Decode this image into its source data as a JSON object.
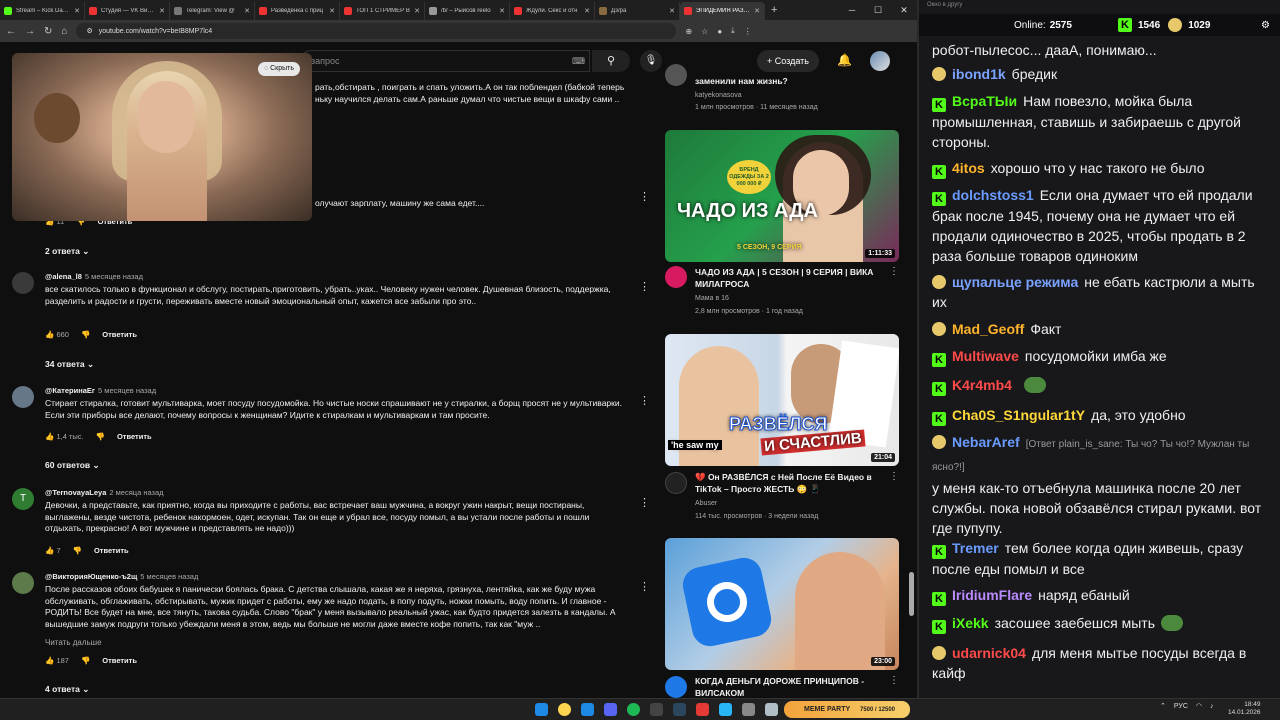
{
  "browser": {
    "tabs": [
      {
        "label": "Stream – Kick Dashboard"
      },
      {
        "label": "Студия — VK Видео"
      },
      {
        "label": "Telegram: View @"
      },
      {
        "label": "Разведёнка с приц"
      },
      {
        "label": "ТОП 1 СТРИМЕР В"
      },
      {
        "label": "/b/ – Рыисов reelо"
      },
      {
        "label": "Ждули. Секс и отн"
      },
      {
        "label": "Дз/ра"
      },
      {
        "label": "ЭПИДЕМИЯ РАЗВЕ"
      }
    ],
    "url": "youtube.com/watch?v=beIB8MP7lc4"
  },
  "youtube": {
    "search_placeholder": "запрос",
    "create_label": "Создать",
    "hide_label": "Скрыть",
    "reply_label": "Ответить",
    "read_more": "Читать дальше",
    "partial_comment": {
      "line1": "рать,обстирать , поиграть и спать уложить.А он так поблендел (бабкой теперь",
      "line2": "ньку научился делать сам.А раньше думал что чистые вещи в шкафу сами ..",
      "line3": "олучают зарплату, машину же сама едет....",
      "likes": "11",
      "replies": "2 ответа"
    },
    "comments": [
      {
        "author": "@alena_l8",
        "time": "5 месяцев назад",
        "text": "все скатилось только в функционал и обслугу, постирать,приготовить, убрать..уках.. Человеку нужен человек. Душевная близость, поддержка, разделить и радости и грусти, переживать вместе новый эмоциональный опыт, кажется все забыли про это..",
        "likes": "660",
        "replies": "34 ответа",
        "avatar": ""
      },
      {
        "author": "@КатеринаЕг",
        "time": "5 месяцев назад",
        "text": "Стирает стиралка, готовит мультиварка, моет посуду посудомойка. Но чистые носки спрашивают не у стиралки, а борщ просят не у мультиварки. Если эти приборы все делают, почему вопросы к женщинам? Идите к стиралкам и мультиваркам и там просите.",
        "likes": "1,4 тыс.",
        "replies": "60 ответов",
        "avatar": ""
      },
      {
        "author": "@TernovayaLeya",
        "time": "2 месяца назад",
        "text": "Девочки, а представьте, как приятно, когда вы приходите с работы, вас встречает ваш мужчина, а вокруг ужин накрыт, вещи постираны, выглажены, везде чистота, ребенок накормоен, одет, искупан. Так он еще и убрал все, посуду помыл, а вы устали после работы и пошли отдыхать, прекрасно! А вот мужчине и представлять не надо)))",
        "likes": "7",
        "replies": "",
        "avatar": "T"
      },
      {
        "author": "@ВикторияЮщенко-ъ2щ",
        "time": "5 месяцев назад",
        "text": "После рассказов обоих бабушек я панически боялась брака. С детства слышала, какая же я неряха, грязнуха, лентяйка, как же буду мужа обслуживать, обглаживать, обстирывать, мужик придет с работы, ему же надо подать, в попу подуть, ножки помыть, воду попить. И главное - РОДИТЬ! Все будет на мне, все тянуть, такова судьба. Слово \"брак\" у меня вызывало реальный ужас, как будто придется залезть в кандалы. А вышедшие замуж подруги только убеждали меня в этом, ведь мы больше не могли даже вместе кофе попить, так как \"муж ..",
        "likes": "187",
        "replies": "4 ответа",
        "avatar": ""
      }
    ],
    "related": [
      {
        "title": "заменили нам жизнь?",
        "channel": "katyekonasova",
        "meta": "1 млн просмотров · 11 месяцев назад",
        "duration": ""
      },
      {
        "title": "ЧАДО ИЗ АДА | 5 СЕЗОН | 9 СЕРИЯ | ВИКА МИЛАГРОСА",
        "channel": "Мама в 16",
        "meta": "2,8 млн просмотров · 1 год назад",
        "duration": "1:11:33",
        "thumb_text": "ЧАДО ИЗ АДА",
        "thumb_sub": "5 СЕЗОН, 9 СЕРИЯ",
        "thumb_badge": "БРЕНД ОДЕЖДЫ ЗА 2 000 000 ₽"
      },
      {
        "title": "💔 Он РАЗВЁЛСЯ с Ней После Её Видео в TikTok – Просто ЖЕСТЬ 😳 📱",
        "channel": "Abuser",
        "meta": "114 тыс. просмотров · 3 недели назад",
        "duration": "21:04",
        "thumb_text": "РАЗВЁЛСЯ",
        "thumb_sub": "И СЧАСТЛИВ",
        "thumb_caption": "'he saw my"
      },
      {
        "title": "КОГДА ДЕНЬГИ ДОРОЖЕ ПРИНЦИПОВ - ВИЛСАКОМ",
        "channel": "",
        "meta": "",
        "duration": "23:00"
      }
    ]
  },
  "chat": {
    "header": "Окно в другу",
    "online_label": "Online:",
    "online": "2575",
    "count1": "1546",
    "count2": "1029",
    "messages": [
      {
        "nick": "",
        "text": "робот-пылесос... дааА, понимаю...",
        "color": "#efeff1",
        "badge": ""
      },
      {
        "nick": "ibond1k",
        "text": "бредик",
        "color": "#7aa2ff",
        "badge": "pog"
      },
      {
        "nick": "ВсраТЫи",
        "text": "Нам повезло, мойка была промышленная, ставишь и забираешь с другой стороны.",
        "color": "#53fc18",
        "badge": "kick"
      },
      {
        "nick": "4itos",
        "text": "хорошо что у нас такого не было",
        "color": "#ffb42b",
        "badge": "kick"
      },
      {
        "nick": "dolchstoss1",
        "text": "Если она думает что ей продали брак после 1945, почему она не думает что ей продали одиночество в 2025, чтобы продать в 2 раза больше товаров одиноким",
        "color": "#6a9cff",
        "badge": "kick"
      },
      {
        "nick": "щупальце режима",
        "text": "не ебать кастрюли а мыть их",
        "color": "#7aa2ff",
        "badge": "pog"
      },
      {
        "nick": "Mad_Geoff",
        "text": "Факт",
        "color": "#ffb42b",
        "badge": "pog"
      },
      {
        "nick": "Multiwave",
        "text": "посудомойки имба же",
        "color": "#ff4a4a",
        "badge": "kick"
      },
      {
        "nick": "K4r4mb4",
        "text": "",
        "color": "#ff4a4a",
        "badge": "kick",
        "emote": "pepe-emote"
      },
      {
        "nick": "Cha0S_S1ngular1tY",
        "text": "да, это удобно",
        "color": "#ffd83a",
        "badge": "kick"
      },
      {
        "nick": "NebarAref",
        "text": "у меня как-то отъебнула машинка после 20 лет службы. пока новой обзавёлся стирал руками. вот где пупупу.",
        "color": "#6a9cff",
        "badge": "pog",
        "reply": "[Ответ plain_is_sane: Ты чо? Ты чо!? Мужлан ты ясно?!]"
      },
      {
        "nick": "Tremer",
        "text": "тем более когда один живешь, сразу после еды помыл и все",
        "color": "#6a9cff",
        "badge": "kick"
      },
      {
        "nick": "IridiumFlare",
        "text": "наряд ебаный",
        "color": "#b98bff",
        "badge": "kick"
      },
      {
        "nick": "iXekk",
        "text": "засошее заебешся мыть",
        "color": "#53fc18",
        "badge": "kick",
        "emote": "pepe-emote"
      },
      {
        "nick": "udarnick04",
        "text": "для меня мытье посуды всегда в кайф",
        "color": "#ff4a4a",
        "badge": "pog"
      }
    ]
  },
  "taskbar": {
    "meme_label": "MEME PARTY",
    "meme_stats": "7500 / 12500",
    "lang": "РУС",
    "time": "18:49",
    "date": "14.01.2026"
  }
}
